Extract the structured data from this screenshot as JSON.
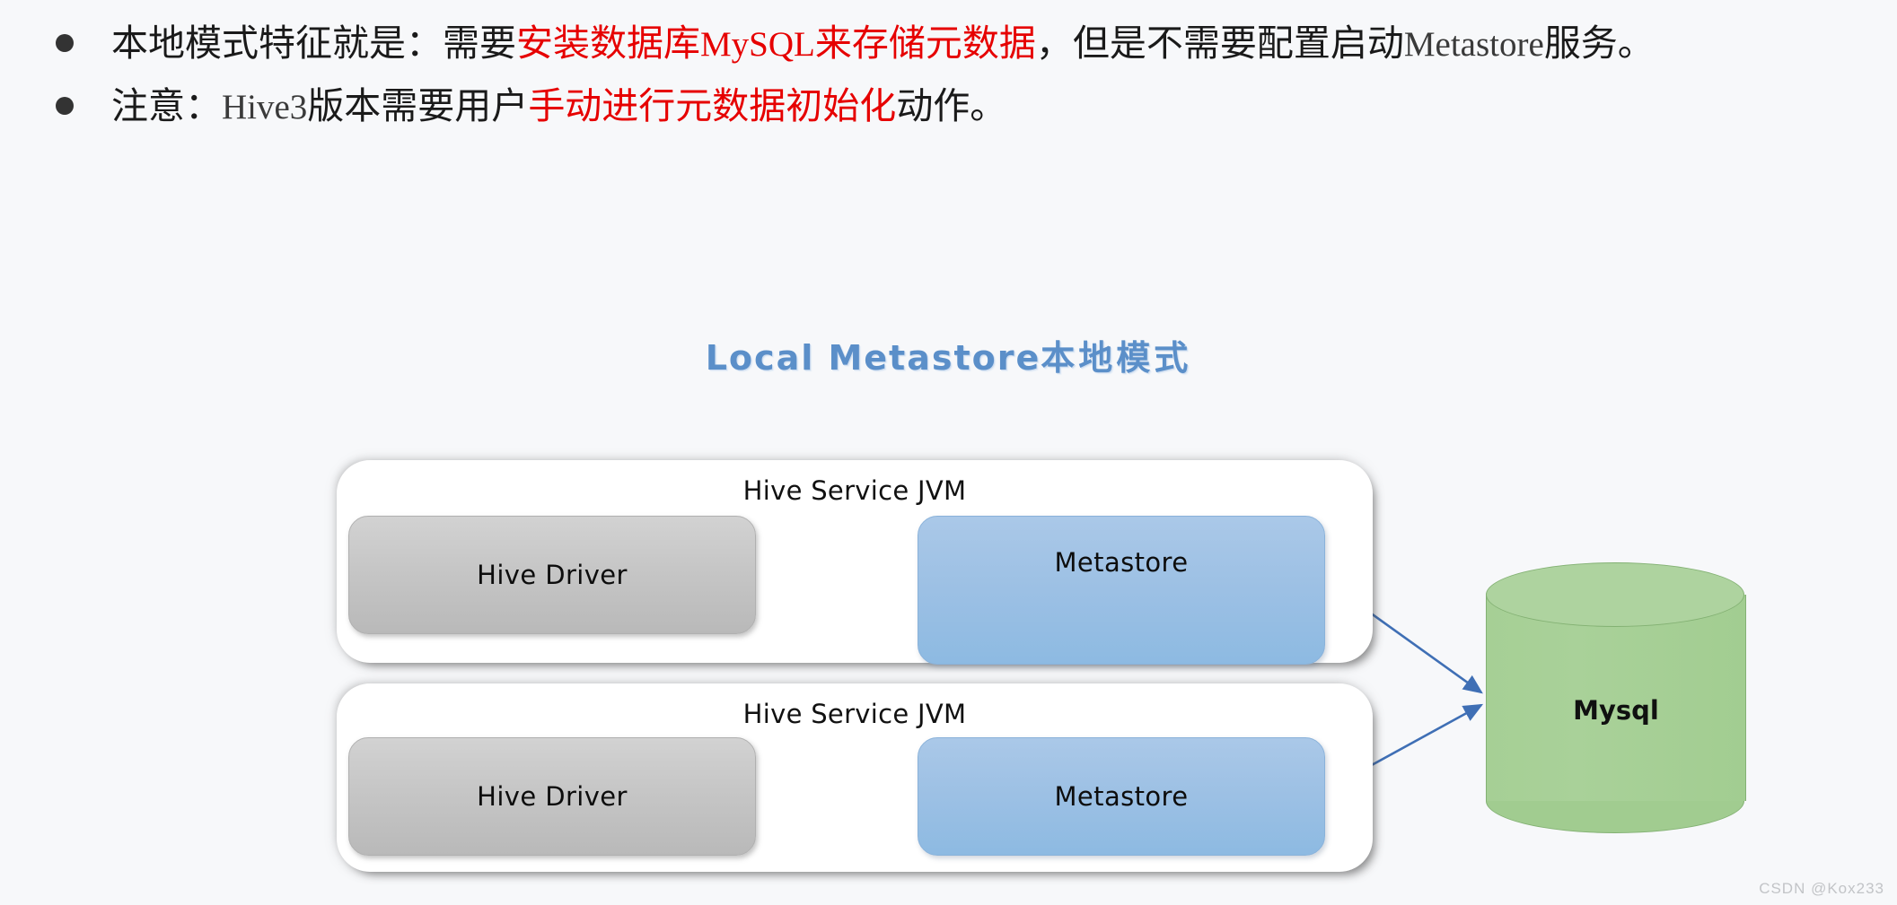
{
  "bullets": [
    {
      "segments": [
        {
          "text": "本地模式特征就是：需要",
          "style": "normal"
        },
        {
          "text": "安装数据库",
          "style": "highlight"
        },
        {
          "text": "MySQL",
          "style": "highlight-mono"
        },
        {
          "text": "来存储元数据",
          "style": "highlight"
        },
        {
          "text": "，但是不需要配置启动",
          "style": "normal"
        },
        {
          "text": "Metastore",
          "style": "mono"
        },
        {
          "text": "服务。",
          "style": "normal"
        }
      ]
    },
    {
      "segments": [
        {
          "text": "注意：",
          "style": "normal"
        },
        {
          "text": "Hive3",
          "style": "mono"
        },
        {
          "text": "版本需要用户",
          "style": "normal"
        },
        {
          "text": "手动进行元数据初始化",
          "style": "highlight"
        },
        {
          "text": "动作。",
          "style": "normal"
        }
      ]
    }
  ],
  "diagram": {
    "title_en": "Local Metastore",
    "title_cn": "本地模式",
    "title_color": "#5b8fc9",
    "jvm_boxes": [
      {
        "label": "Hive Service JVM",
        "driver_label": "Hive Driver",
        "metastore_label": "Metastore"
      },
      {
        "label": "Hive Service JVM",
        "driver_label": "Hive Driver",
        "metastore_label": "Metastore"
      }
    ],
    "database": {
      "label": "Mysql",
      "color": "#a6cf95"
    },
    "arrow_color": "#3f6fb5",
    "driver_color": "#c6c6c6",
    "metastore_color": "#9cc0e4"
  },
  "watermark": "CSDN @Kox233"
}
